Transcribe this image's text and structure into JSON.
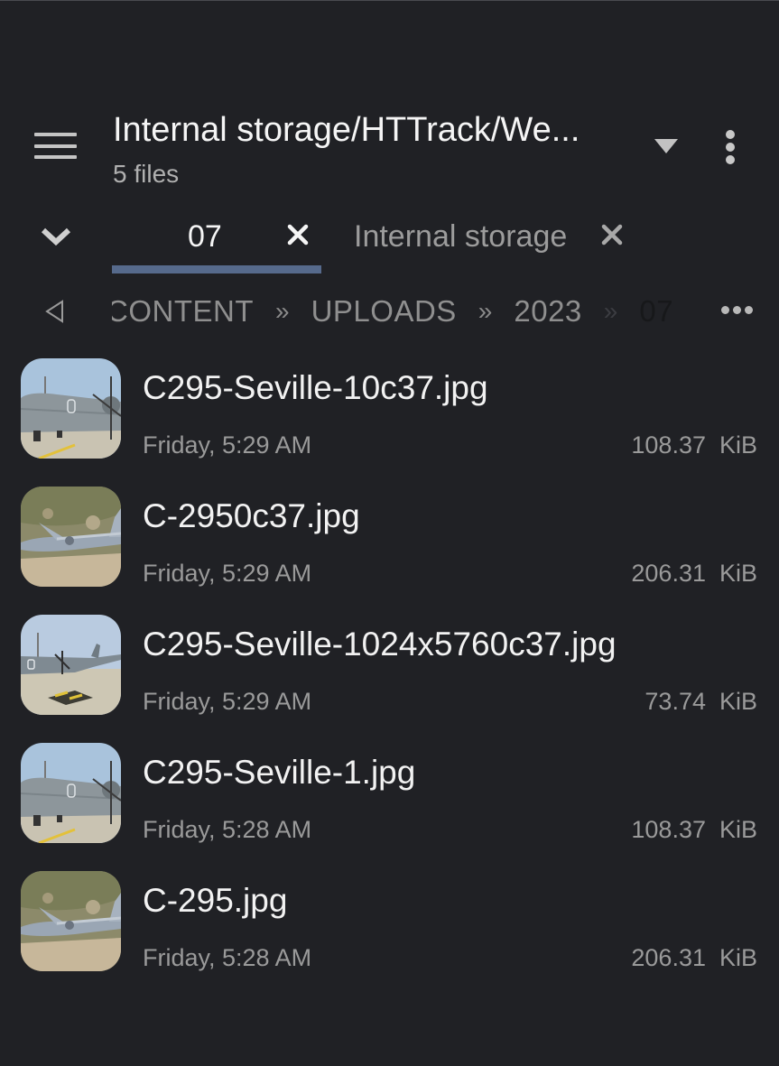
{
  "header": {
    "title": "Internal storage/HTTrack/We...",
    "subtitle": "5 files",
    "icons": {
      "menu": "hamburger-menu-icon",
      "dropdown": "dropdown-triangle-icon",
      "overflow": "more-vert-icon"
    }
  },
  "tabs": {
    "expand_icon": "chevron-down-icon",
    "items": [
      {
        "label": "07",
        "active": true,
        "close_icon": "close-icon"
      },
      {
        "label": "Internal storage",
        "active": false,
        "close_icon": "close-icon"
      }
    ],
    "accent_color": "#566a8c"
  },
  "breadcrumb": {
    "back_icon": "triangle-left-icon",
    "segments": [
      "CONTENT",
      "UPLOADS",
      "2023",
      "07"
    ],
    "separator": "»",
    "more_icon": "more-horiz-icon"
  },
  "files": [
    {
      "name": "C295-Seville-10c37.jpg",
      "date": "Friday, 5:29 AM",
      "size": "108.37  KiB",
      "thumb": "parked-aircraft"
    },
    {
      "name": "C-2950c37.jpg",
      "date": "Friday, 5:29 AM",
      "size": "206.31  KiB",
      "thumb": "flying-aircraft"
    },
    {
      "name": "C295-Seville-1024x5760c37.jpg",
      "date": "Friday, 5:29 AM",
      "size": "73.74  KiB",
      "thumb": "runway-aircraft"
    },
    {
      "name": "C295-Seville-1.jpg",
      "date": "Friday, 5:28 AM",
      "size": "108.37  KiB",
      "thumb": "parked-aircraft"
    },
    {
      "name": "C-295.jpg",
      "date": "Friday, 5:28 AM",
      "size": "206.31  KiB",
      "thumb": "flying-aircraft"
    }
  ],
  "colors": {
    "background": "#202125",
    "primary_text": "#f2f2f2",
    "secondary_text": "#9a9a9a"
  }
}
